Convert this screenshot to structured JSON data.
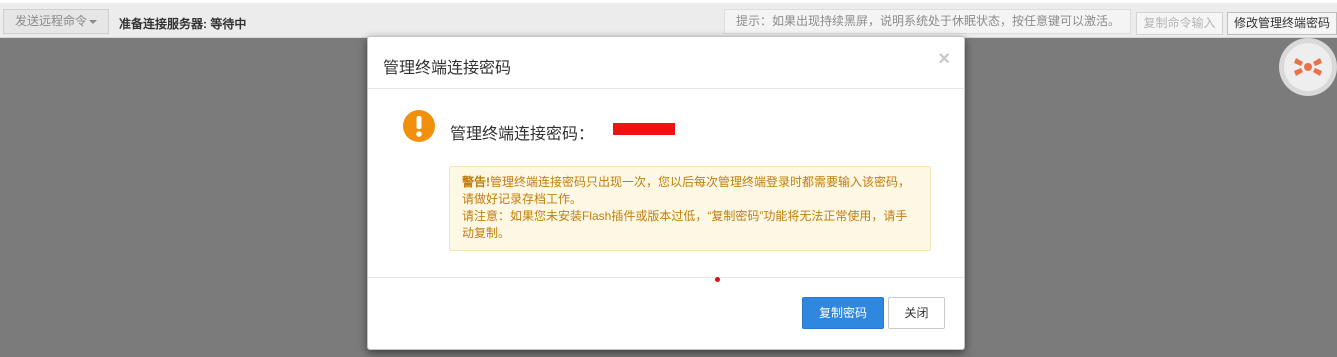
{
  "toolbar": {
    "remote_command_label": "发送远程命令",
    "status_text": "准备连接服务器: 等待中",
    "hint_text": "提示：如果出现持续黑屏，说明系统处于休眠状态，按任意键可以激活。",
    "copy_command_label": "复制命令输入",
    "edit_password_label": "修改管理终端密码"
  },
  "modal": {
    "title": "管理终端连接密码",
    "close_glyph": "×",
    "password_label": "管理终端连接密码：",
    "password_value": "",
    "alert_warning_title": "警告!",
    "alert_warning_text": "管理终端连接密码只出现一次，您以后每次管理终端登录时都需要输入该密码，请做好记录存档工作。",
    "alert_note_text": "请注意：如果您未安装Flash插件或版本过低，“复制密码”功能将无法正常使用，请手动复制。",
    "copy_password_label": "复制密码",
    "close_label": "关闭"
  },
  "colors": {
    "primary": "#2f87e0",
    "warning": "#f0900d",
    "alert_text": "#c27d0e",
    "alert_bg": "#fcf8e3",
    "backdrop": "#7b7b7b"
  },
  "icons": {
    "warn": "exclamation-circle",
    "close": "close-x",
    "caret": "caret-down",
    "logo": "corner-logo"
  }
}
